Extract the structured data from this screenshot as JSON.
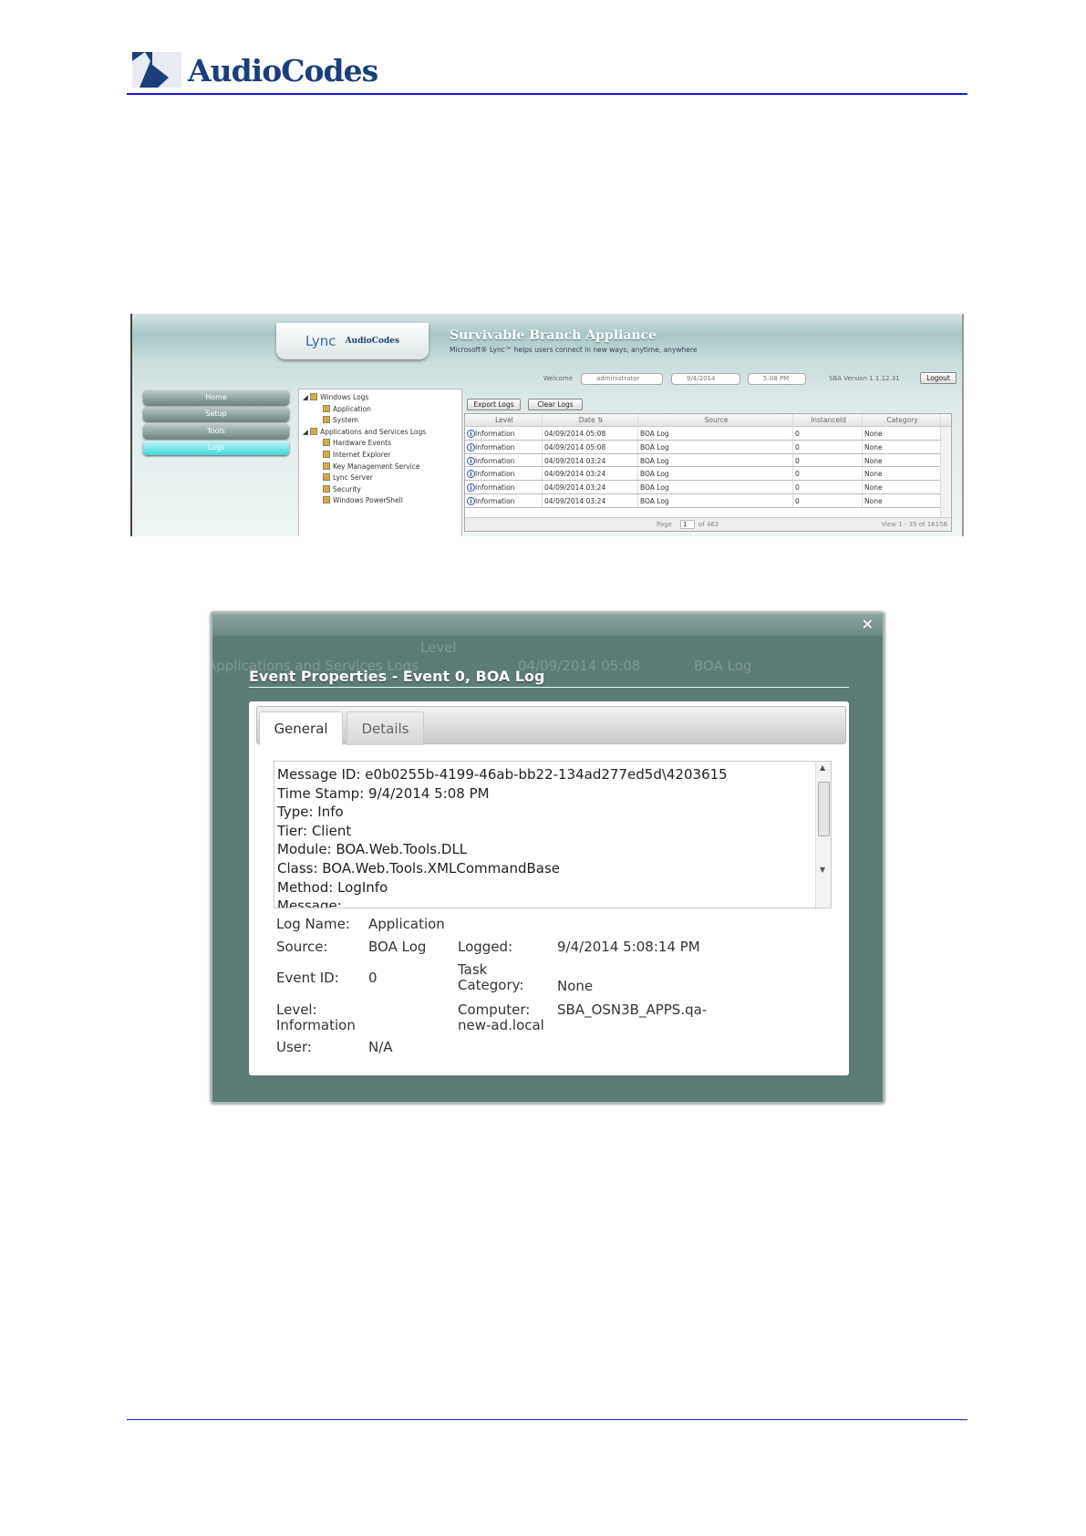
{
  "brand": {
    "name": "AudioCodes"
  },
  "app": {
    "lync": "Lync",
    "audiocodes": "AudioCodes",
    "title": "Survivable Branch Appliance",
    "subtitle": "Microsoft® Lync™ helps users connect in new ways, anytime, anywhere",
    "welcome": "Welcome",
    "user": "administrator",
    "date": "9/4/2014",
    "time": "5:08 PM",
    "version": "SBA Version 1.1.12.31",
    "logout": "Logout"
  },
  "nav": [
    "Home",
    "Setup",
    "Tools",
    "Logs"
  ],
  "tree": [
    {
      "label": "Windows Logs",
      "level": 0
    },
    {
      "label": "Application",
      "level": 1
    },
    {
      "label": "System",
      "level": 1
    },
    {
      "label": "Applications and Services Logs",
      "level": 0
    },
    {
      "label": "Hardware Events",
      "level": 1
    },
    {
      "label": "Internet Explorer",
      "level": 1
    },
    {
      "label": "Key Management Service",
      "level": 1
    },
    {
      "label": "Lync Server",
      "level": 1
    },
    {
      "label": "Security",
      "level": 1
    },
    {
      "label": "Windows PowerShell",
      "level": 1
    }
  ],
  "toolbar": {
    "export": "Export Logs",
    "clear": "Clear Logs"
  },
  "grid": {
    "columns": [
      "Level",
      "Date ⇅",
      "Source",
      "InstanceId",
      "Category"
    ],
    "rows": [
      [
        "Information",
        "04/09/2014 05:08",
        "BOA Log",
        "0",
        "None"
      ],
      [
        "Information",
        "04/09/2014 05:08",
        "BOA Log",
        "0",
        "None"
      ],
      [
        "Information",
        "04/09/2014 03:24",
        "BOA Log",
        "0",
        "None"
      ],
      [
        "Information",
        "04/09/2014 03:24",
        "BOA Log",
        "0",
        "None"
      ],
      [
        "Information",
        "04/09/2014 03:24",
        "BOA Log",
        "0",
        "None"
      ],
      [
        "Information",
        "04/09/2014 03:24",
        "BOA Log",
        "0",
        "None"
      ]
    ],
    "page_label": "Page",
    "page": "1",
    "of_pages": "of 462",
    "view": "View 1 - 35 of 16156"
  },
  "dialog": {
    "title": "Event Properties - Event 0, BOA Log",
    "tabs": [
      "General",
      "Details"
    ],
    "message_lines": [
      "Message ID: e0b0255b-4199-46ab-bb22-134ad277ed5d\\4203615",
      "Time Stamp: 9/4/2014 5:08 PM",
      "Type: Info",
      "Tier: Client",
      "Module: BOA.Web.Tools.DLL",
      "Class: BOA.Web.Tools.XMLCommandBase",
      "Method: LogInfo",
      "Message:"
    ],
    "fields": {
      "log_name_label": "Log Name:",
      "log_name": "Application",
      "source_label": "Source:",
      "source": "BOA Log",
      "logged_label": "Logged:",
      "logged": "9/4/2014 5:08:14 PM",
      "event_id_label": "Event ID:",
      "event_id": "0",
      "task_label": "Task Category:",
      "task": "None",
      "level_label": "Level: Information",
      "computer_label": "Computer: new-ad.local",
      "computer": "SBA_OSN3B_APPS.qa-",
      "user_label": "User:",
      "user": "N/A"
    }
  }
}
